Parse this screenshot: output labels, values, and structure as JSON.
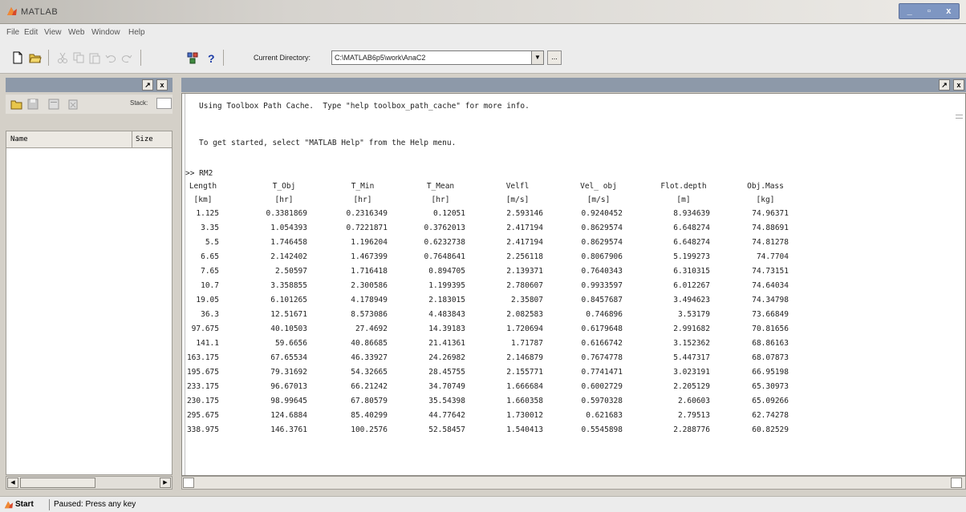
{
  "window": {
    "title": "MATLAB",
    "min": "_",
    "max": "▫",
    "close": "x"
  },
  "menu": [
    "File",
    "Edit",
    "View",
    "Web",
    "Window",
    "Help"
  ],
  "toolbar": {
    "current_dir_label": "Current Directory:",
    "current_dir_value": "C:\\MATLAB6p5\\work\\AnaC2",
    "dropdown_glyph": "▼",
    "browse_glyph": "..."
  },
  "workspace": {
    "stack_label": "Stack:",
    "col_name": "Name",
    "col_size": "Size",
    "title_btns": [
      "↗",
      "x"
    ],
    "scroll_left": "◀",
    "scroll_right": "▶"
  },
  "command_window": {
    "title_btns": [
      "↗",
      "x"
    ],
    "lines": [
      "Using Toolbox Path Cache.  Type \"help toolbox_path_cache\" for more info.",
      "To get started, select \"MATLAB Help\" from the Help menu."
    ],
    "prompt": ">> RM2",
    "table": {
      "headers": [
        "Length",
        "T_Obj",
        "T_Min",
        "T_Mean",
        "Velfl",
        "Vel_ obj",
        "Flot.depth",
        "Obj.Mass"
      ],
      "units": [
        "[km]",
        "[hr]",
        "[hr]",
        "[hr]",
        "[m/s]",
        "[m/s]",
        "[m]",
        "[kg]"
      ],
      "rows": [
        [
          "1.125",
          "0.3381869",
          "0.2316349",
          "0.12051",
          "2.593146",
          "0.9240452",
          "8.934639",
          "74.96371"
        ],
        [
          "3.35",
          "1.054393",
          "0.7221871",
          "0.3762013",
          "2.417194",
          "0.8629574",
          "6.648274",
          "74.88691"
        ],
        [
          "5.5",
          "1.746458",
          "1.196204",
          "0.6232738",
          "2.417194",
          "0.8629574",
          "6.648274",
          "74.81278"
        ],
        [
          "6.65",
          "2.142402",
          "1.467399",
          "0.7648641",
          "2.256118",
          "0.8067906",
          "5.199273",
          "74.7704"
        ],
        [
          "7.65",
          "2.50597",
          "1.716418",
          "0.894705",
          "2.139371",
          "0.7640343",
          "6.310315",
          "74.73151"
        ],
        [
          "10.7",
          "3.358855",
          "2.300586",
          "1.199395",
          "2.780607",
          "0.9933597",
          "6.012267",
          "74.64034"
        ],
        [
          "19.05",
          "6.101265",
          "4.178949",
          "2.183015",
          "2.35807",
          "0.8457687",
          "3.494623",
          "74.34798"
        ],
        [
          "36.3",
          "12.51671",
          "8.573086",
          "4.483843",
          "2.082583",
          "0.746896",
          "3.53179",
          "73.66849"
        ],
        [
          "97.675",
          "40.10503",
          "27.4692",
          "14.39183",
          "1.720694",
          "0.6179648",
          "2.991682",
          "70.81656"
        ],
        [
          "141.1",
          "59.6656",
          "40.86685",
          "21.41361",
          "1.71787",
          "0.6166742",
          "3.152362",
          "68.86163"
        ],
        [
          "163.175",
          "67.65534",
          "46.33927",
          "24.26982",
          "2.146879",
          "0.7674778",
          "5.447317",
          "68.07873"
        ],
        [
          "195.675",
          "79.31692",
          "54.32665",
          "28.45755",
          "2.155771",
          "0.7741471",
          "3.023191",
          "66.95198"
        ],
        [
          "233.175",
          "96.67013",
          "66.21242",
          "34.70749",
          "1.666684",
          "0.6002729",
          "2.205129",
          "65.30973"
        ],
        [
          "230.175",
          "98.99645",
          "67.80579",
          "35.54398",
          "1.660358",
          "0.5970328",
          "2.60603",
          "65.09266"
        ],
        [
          "295.675",
          "124.6884",
          "85.40299",
          "44.77642",
          "1.730012",
          "0.621683",
          "2.79513",
          "62.74278"
        ],
        [
          "338.975",
          "146.3761",
          "100.2576",
          "52.58457",
          "1.540413",
          "0.5545898",
          "2.288776",
          "60.82529"
        ]
      ]
    }
  },
  "status": {
    "start": "Start",
    "text": "Paused: Press any key"
  }
}
